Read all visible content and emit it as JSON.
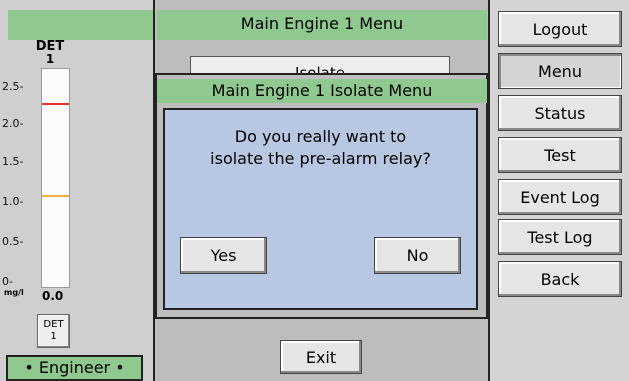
{
  "left_panel": {
    "detector_label": "DET",
    "detector_number": "1",
    "gauge": {
      "ticks": [
        "2.5-",
        "2.0-",
        "1.5-",
        "1.0-",
        "0.5-",
        "0-"
      ],
      "alarm_level": 2.2,
      "prealarm_level": 1.1,
      "alarm_color": "#e03030",
      "prealarm_color": "#f0b040",
      "max": 2.6
    },
    "unit": "mg/l",
    "reading": "0.0",
    "detector_button": {
      "line1": "DET",
      "line2": "1"
    },
    "user_role": "• Engineer •"
  },
  "menu": {
    "title": "Main Engine 1 Menu",
    "behind_button": "Isolate",
    "exit_label": "Exit"
  },
  "isolate_menu": {
    "title": "Main Engine 1 Isolate Menu"
  },
  "dialog": {
    "line1": "Do you really want to",
    "line2": "isolate the pre-alarm relay?",
    "yes_label": "Yes",
    "no_label": "No"
  },
  "nav": {
    "items": [
      "Logout",
      "Menu",
      "Status",
      "Test",
      "Event Log",
      "Test Log",
      "Back"
    ],
    "active": "Menu"
  },
  "colors": {
    "header_green": "#8fc98f",
    "dialog_blue": "#b9c8e2"
  }
}
